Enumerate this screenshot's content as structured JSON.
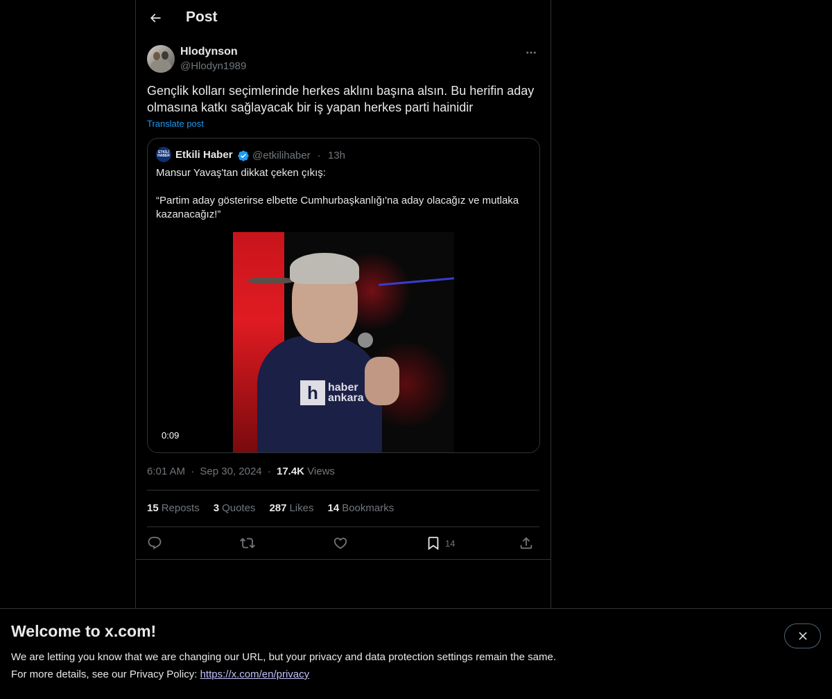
{
  "header": {
    "title": "Post"
  },
  "author": {
    "name": "Hlodynson",
    "handle": "@Hlodyn1989"
  },
  "post": {
    "text": "Gençlik kolları seçimlerinde herkes aklını başına alsın. Bu herifin aday olmasına katkı sağlayacak bir iş yapan herkes parti hainidir",
    "translate_label": "Translate post"
  },
  "quote": {
    "name": "Etkili Haber",
    "avatar_text": "ETKİLİ HABER",
    "handle": "@etkilihaber",
    "separator": "·",
    "time": "13h",
    "text": "Mansur Yavaş'tan dikkat çeken çıkış:\n\n“Partim aday gösterirse elbette Cumhurbaşkanlığı'na aday olacağız ve mutlaka kazanacağız!”",
    "video_duration": "0:09",
    "watermark_letter": "h",
    "watermark_text_1": "haber",
    "watermark_text_2": "ankara"
  },
  "meta": {
    "time": "6:01 AM",
    "sep1": "·",
    "date": "Sep 30, 2024",
    "sep2": "·",
    "views_count": "17.4K",
    "views_label": "Views"
  },
  "stats": [
    {
      "count": "15",
      "label": "Reposts"
    },
    {
      "count": "3",
      "label": "Quotes"
    },
    {
      "count": "287",
      "label": "Likes"
    },
    {
      "count": "14",
      "label": "Bookmarks"
    }
  ],
  "actions": {
    "bookmark_count": "14"
  },
  "banner": {
    "title": "Welcome to x.com!",
    "line1": "We are letting you know that we are changing our URL, but your privacy and data protection settings remain the same.",
    "line2_prefix": "For more details, see our Privacy Policy: ",
    "link": "https://x.com/en/privacy"
  },
  "colors": {
    "accent": "#1d9bf0",
    "muted": "#71767b",
    "border": "#2f3336",
    "link_banner": "#c1c0f9"
  }
}
